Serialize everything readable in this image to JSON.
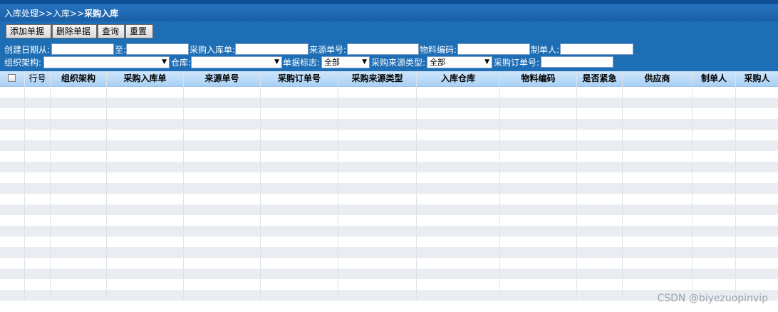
{
  "breadcrumb": {
    "prefix": "入库处理>>入库>>",
    "current": "采购入库"
  },
  "toolbar": {
    "add": "添加单据",
    "delete": "删除单据",
    "query": "查询",
    "reset": "重置"
  },
  "filters": {
    "created_from": "创建日期从:",
    "created_to": "至:",
    "purchase_inbound_no": "采购入库单:",
    "source_no": "来源单号:",
    "material_code": "物料编码:",
    "creator": "制单人:",
    "org": "组织架构:",
    "warehouse": "仓库:",
    "doc_flag": "单据标志:",
    "doc_flag_value": "全部",
    "source_type": "采购来源类型:",
    "source_type_value": "全部",
    "po_no": "采购订单号:"
  },
  "table": {
    "columns": [
      "行号",
      "组织架构",
      "采购入库单",
      "来源单号",
      "采购订单号",
      "采购来源类型",
      "入库仓库",
      "物料编码",
      "是否紧急",
      "供应商",
      "制单人",
      "采购人"
    ],
    "rows": []
  },
  "watermark": "CSDN @biyezuopinvip"
}
